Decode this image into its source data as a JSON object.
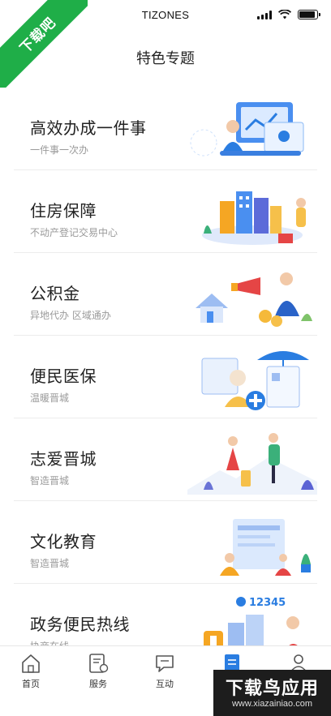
{
  "status_bar": {
    "carrier": "TIZONES"
  },
  "watermark": {
    "ribbon_text": "下载吧",
    "box_title": "下载鸟应用",
    "box_url": "www.xiazainiao.com"
  },
  "header": {
    "title": "特色专题"
  },
  "topics": [
    {
      "title": "高效办成一件事",
      "subtitle": "一件事一次办",
      "illustration": "office-worker-illustration"
    },
    {
      "title": "住房保障",
      "subtitle": "不动产登记交易中心",
      "illustration": "city-housing-illustration"
    },
    {
      "title": "公积金",
      "subtitle": "异地代办 区域通办",
      "illustration": "fund-house-illustration"
    },
    {
      "title": "便民医保",
      "subtitle": "温暖晋城",
      "illustration": "medical-insurance-illustration"
    },
    {
      "title": "志爱晋城",
      "subtitle": "智造晋城",
      "illustration": "travel-volunteer-illustration"
    },
    {
      "title": "文化教育",
      "subtitle": "智造晋城",
      "illustration": "education-reading-illustration"
    },
    {
      "title": "政务便民热线",
      "subtitle": "协商在线",
      "illustration": "hotline-12345-illustration",
      "badge": "12345"
    }
  ],
  "tab_bar": {
    "tabs": [
      {
        "label": "首页",
        "icon": "home-icon"
      },
      {
        "label": "服务",
        "icon": "service-icon"
      },
      {
        "label": "互动",
        "icon": "chat-icon"
      },
      {
        "label": "",
        "icon": "topic-icon",
        "active": true
      },
      {
        "label": "",
        "icon": "user-icon"
      }
    ]
  },
  "colors": {
    "accent": "#2a7de1",
    "watermark_green": "#1fae48",
    "text": "#222222",
    "muted": "#9a9a9a"
  }
}
